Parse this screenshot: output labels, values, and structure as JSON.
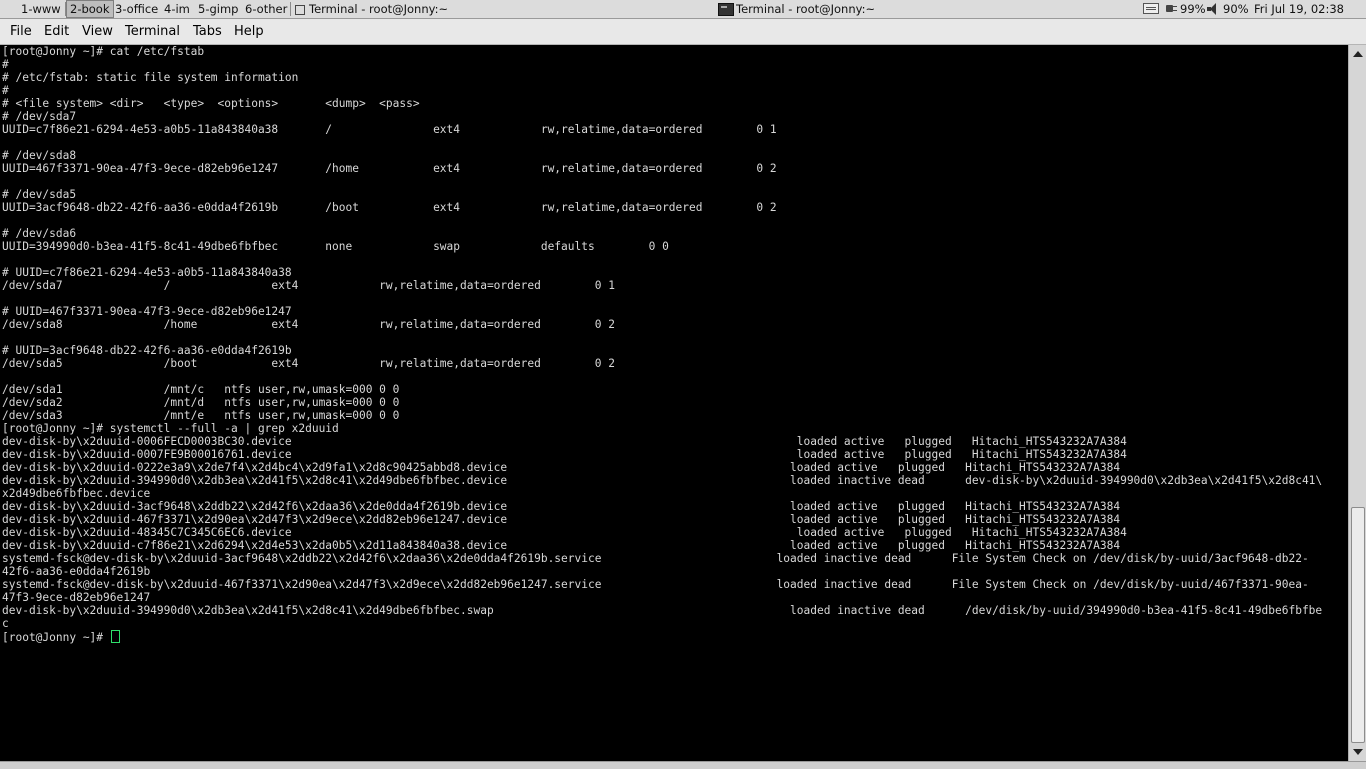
{
  "panel": {
    "workspaces": [
      "1-www",
      "2-book",
      "3-office",
      "4-im",
      "5-gimp",
      "6-other"
    ],
    "active_workspace": "2-book",
    "active_window_title": "Terminal - root@Jonny:~",
    "task_title": "Terminal - root@Jonny:~",
    "battery": "99%",
    "volume": "90%",
    "clock": "Fri Jul 19, 02:38"
  },
  "menubar": {
    "items": [
      "File",
      "Edit",
      "View",
      "Terminal",
      "Tabs",
      "Help"
    ]
  },
  "terminal": {
    "lines": [
      "[root@Jonny ~]# cat /etc/fstab",
      "#",
      "# /etc/fstab: static file system information",
      "#",
      "# <file system> <dir>   <type>  <options>       <dump>  <pass>",
      "# /dev/sda7",
      "UUID=c7f86e21-6294-4e53-a0b5-11a843840a38       /               ext4            rw,relatime,data=ordered        0 1",
      "",
      "# /dev/sda8",
      "UUID=467f3371-90ea-47f3-9ece-d82eb96e1247       /home           ext4            rw,relatime,data=ordered        0 2",
      "",
      "# /dev/sda5",
      "UUID=3acf9648-db22-42f6-aa36-e0dda4f2619b       /boot           ext4            rw,relatime,data=ordered        0 2",
      "",
      "# /dev/sda6",
      "UUID=394990d0-b3ea-41f5-8c41-49dbe6fbfbec       none            swap            defaults        0 0",
      "",
      "# UUID=c7f86e21-6294-4e53-a0b5-11a843840a38",
      "/dev/sda7               /               ext4            rw,relatime,data=ordered        0 1",
      "",
      "# UUID=467f3371-90ea-47f3-9ece-d82eb96e1247",
      "/dev/sda8               /home           ext4            rw,relatime,data=ordered        0 2",
      "",
      "# UUID=3acf9648-db22-42f6-aa36-e0dda4f2619b",
      "/dev/sda5               /boot           ext4            rw,relatime,data=ordered        0 2",
      "",
      "/dev/sda1               /mnt/c   ntfs user,rw,umask=000 0 0",
      "/dev/sda2               /mnt/d   ntfs user,rw,umask=000 0 0",
      "/dev/sda3               /mnt/e   ntfs user,rw,umask=000 0 0",
      "[root@Jonny ~]# systemctl --full -a | grep x2duuid",
      "dev-disk-by\\x2duuid-0006FECD0003BC30.device                                                                           loaded active   plugged   Hitachi_HTS543232A7A384",
      "dev-disk-by\\x2duuid-0007FE9B00016761.device                                                                           loaded active   plugged   Hitachi_HTS543232A7A384",
      "dev-disk-by\\x2duuid-0222e3a9\\x2de7f4\\x2d4bc4\\x2d9fa1\\x2d8c90425abbd8.device                                          loaded active   plugged   Hitachi_HTS543232A7A384",
      "dev-disk-by\\x2duuid-394990d0\\x2db3ea\\x2d41f5\\x2d8c41\\x2d49dbe6fbfbec.device                                          loaded inactive dead      dev-disk-by\\x2duuid-394990d0\\x2db3ea\\x2d41f5\\x2d8c41\\",
      "x2d49dbe6fbfbec.device",
      "dev-disk-by\\x2duuid-3acf9648\\x2ddb22\\x2d42f6\\x2daa36\\x2de0dda4f2619b.device                                          loaded active   plugged   Hitachi_HTS543232A7A384",
      "dev-disk-by\\x2duuid-467f3371\\x2d90ea\\x2d47f3\\x2d9ece\\x2dd82eb96e1247.device                                          loaded active   plugged   Hitachi_HTS543232A7A384",
      "dev-disk-by\\x2duuid-48345C7C345C6EC6.device                                                                           loaded active   plugged   Hitachi_HTS543232A7A384",
      "dev-disk-by\\x2duuid-c7f86e21\\x2d6294\\x2d4e53\\x2da0b5\\x2d11a843840a38.device                                          loaded active   plugged   Hitachi_HTS543232A7A384",
      "systemd-fsck@dev-disk-by\\x2duuid-3acf9648\\x2ddb22\\x2d42f6\\x2daa36\\x2de0dda4f2619b.service                          loaded inactive dead      File System Check on /dev/disk/by-uuid/3acf9648-db22-",
      "42f6-aa36-e0dda4f2619b",
      "systemd-fsck@dev-disk-by\\x2duuid-467f3371\\x2d90ea\\x2d47f3\\x2d9ece\\x2dd82eb96e1247.service                          loaded inactive dead      File System Check on /dev/disk/by-uuid/467f3371-90ea-",
      "47f3-9ece-d82eb96e1247",
      "dev-disk-by\\x2duuid-394990d0\\x2db3ea\\x2d41f5\\x2d8c41\\x2d49dbe6fbfbec.swap                                            loaded inactive dead      /dev/disk/by-uuid/394990d0-b3ea-41f5-8c41-49dbe6fbfbe",
      "c"
    ],
    "prompt": "[root@Jonny ~]# "
  }
}
